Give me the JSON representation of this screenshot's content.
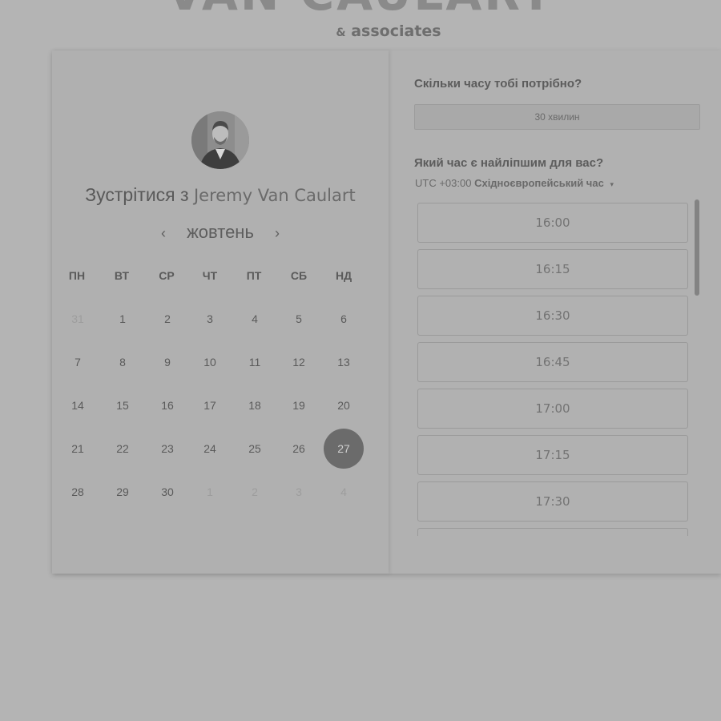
{
  "brand": {
    "name": "VAN CAULART",
    "sub_amp": "&",
    "sub_text": "associates"
  },
  "host": {
    "prefix": "Зустрітися з",
    "name": "Jeremy Van Caulart"
  },
  "calendar": {
    "month": "жовтень",
    "prev_icon": "‹",
    "next_icon": "›",
    "weekdays": [
      "ПН",
      "ВТ",
      "СР",
      "ЧТ",
      "ПТ",
      "СБ",
      "НД"
    ],
    "weeks": [
      [
        {
          "d": "31",
          "muted": true
        },
        {
          "d": "1"
        },
        {
          "d": "2"
        },
        {
          "d": "3"
        },
        {
          "d": "4"
        },
        {
          "d": "5"
        },
        {
          "d": "6"
        }
      ],
      [
        {
          "d": "7"
        },
        {
          "d": "8"
        },
        {
          "d": "9"
        },
        {
          "d": "10"
        },
        {
          "d": "11"
        },
        {
          "d": "12"
        },
        {
          "d": "13"
        }
      ],
      [
        {
          "d": "14"
        },
        {
          "d": "15"
        },
        {
          "d": "16"
        },
        {
          "d": "17"
        },
        {
          "d": "18"
        },
        {
          "d": "19"
        },
        {
          "d": "20"
        }
      ],
      [
        {
          "d": "21"
        },
        {
          "d": "22"
        },
        {
          "d": "23"
        },
        {
          "d": "24"
        },
        {
          "d": "25"
        },
        {
          "d": "26"
        },
        {
          "d": "27",
          "selected": true
        }
      ],
      [
        {
          "d": "28"
        },
        {
          "d": "29"
        },
        {
          "d": "30"
        },
        {
          "d": "1",
          "muted": true
        },
        {
          "d": "2",
          "muted": true
        },
        {
          "d": "3",
          "muted": true
        },
        {
          "d": "4",
          "muted": true
        }
      ]
    ],
    "selected_color": "#6b6b6b"
  },
  "booking": {
    "duration_question": "Скільки часу тобі потрібно?",
    "duration_value": "30 хвилин",
    "time_question": "Який час є найліпшим для вас?",
    "tz_offset": "UTC +03:00",
    "tz_name": "Східноєвропейський час",
    "tz_caret": "▾",
    "slots": [
      "16:00",
      "16:15",
      "16:30",
      "16:45",
      "17:00",
      "17:15",
      "17:30",
      ""
    ]
  }
}
